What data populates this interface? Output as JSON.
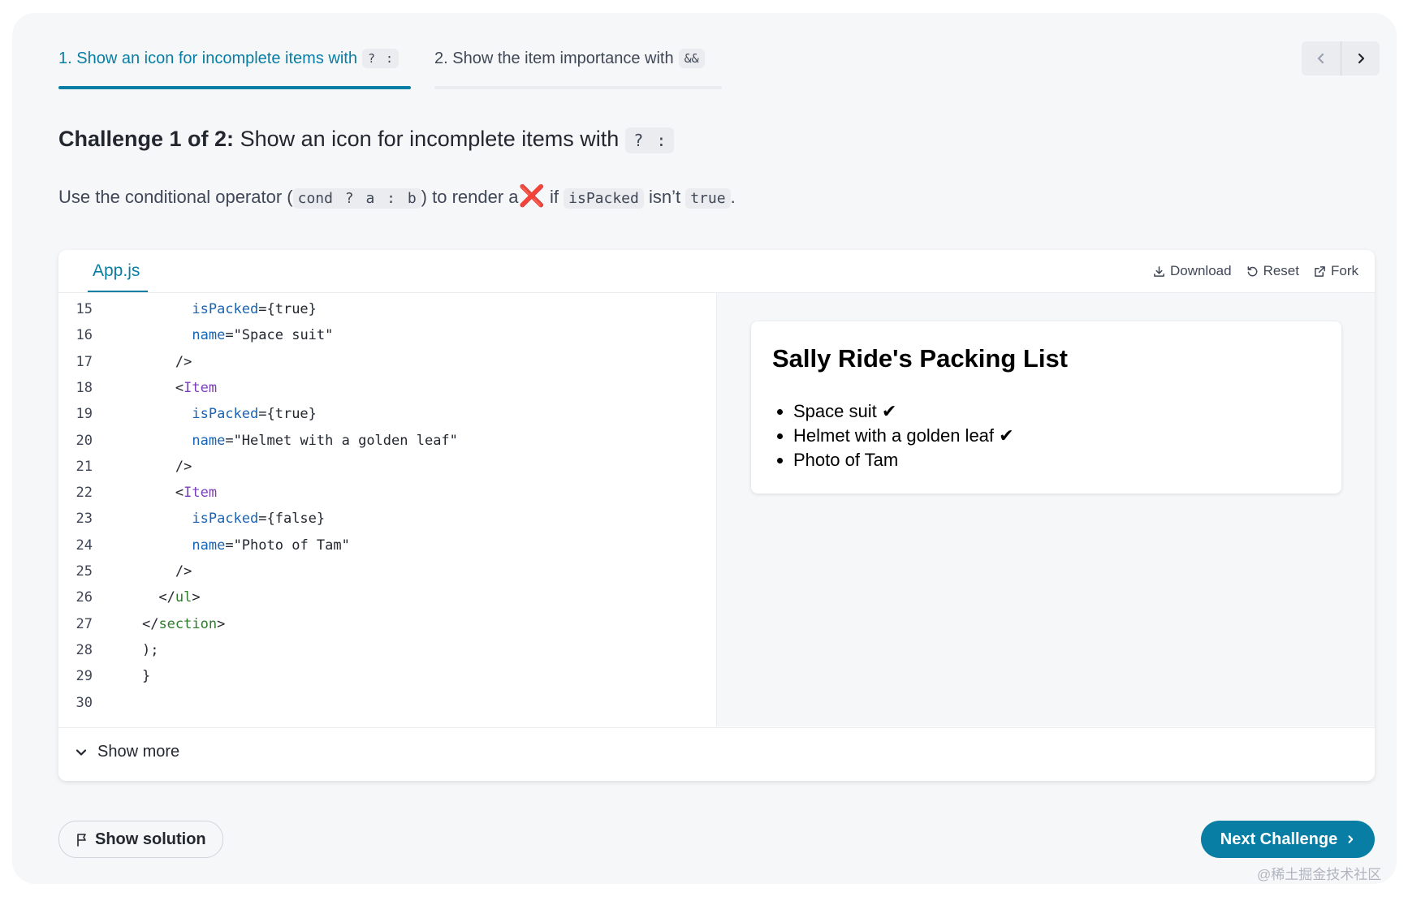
{
  "tabs": [
    {
      "label": "1. Show an icon for incomplete items with",
      "code": "? :",
      "active": true
    },
    {
      "label": "2. Show the item importance with",
      "code": "&&",
      "active": false
    }
  ],
  "challenge": {
    "prefix": "Challenge 1 of 2:",
    "title": "Show an icon for incomplete items with",
    "code": "? :",
    "desc": {
      "t1": "Use the conditional operator (",
      "c1": "cond ? a : b",
      "t2": ") to render a",
      "icon": "❌",
      "t3": "if",
      "c2": "isPacked",
      "t4": "isn’t",
      "c3": "true",
      "t5": "."
    }
  },
  "sandbox": {
    "file_tab": "App.js",
    "actions": {
      "download": "Download",
      "reset": "Reset",
      "fork": "Fork"
    },
    "code_lines": [
      {
        "n": "15",
        "indent": "      ",
        "parts": [
          [
            "attr",
            "isPacked"
          ],
          [
            "plain",
            "={true}"
          ]
        ]
      },
      {
        "n": "16",
        "indent": "      ",
        "parts": [
          [
            "attr",
            "name"
          ],
          [
            "plain",
            "="
          ],
          [
            "str",
            "\"Space suit\""
          ]
        ]
      },
      {
        "n": "17",
        "indent": "    ",
        "parts": [
          [
            "plain",
            "/>"
          ]
        ]
      },
      {
        "n": "18",
        "indent": "    ",
        "parts": [
          [
            "plain",
            "<"
          ],
          [
            "tag",
            "Item"
          ]
        ]
      },
      {
        "n": "19",
        "indent": "      ",
        "parts": [
          [
            "attr",
            "isPacked"
          ],
          [
            "plain",
            "={true}"
          ]
        ]
      },
      {
        "n": "20",
        "indent": "      ",
        "parts": [
          [
            "attr",
            "name"
          ],
          [
            "plain",
            "="
          ],
          [
            "str",
            "\"Helmet with a golden leaf\""
          ]
        ]
      },
      {
        "n": "21",
        "indent": "    ",
        "parts": [
          [
            "plain",
            "/>"
          ]
        ]
      },
      {
        "n": "22",
        "indent": "    ",
        "parts": [
          [
            "plain",
            "<"
          ],
          [
            "tag",
            "Item"
          ]
        ]
      },
      {
        "n": "23",
        "indent": "      ",
        "parts": [
          [
            "attr",
            "isPacked"
          ],
          [
            "plain",
            "={false}"
          ]
        ]
      },
      {
        "n": "24",
        "indent": "      ",
        "parts": [
          [
            "attr",
            "name"
          ],
          [
            "plain",
            "="
          ],
          [
            "str",
            "\"Photo of Tam\""
          ]
        ]
      },
      {
        "n": "25",
        "indent": "    ",
        "parts": [
          [
            "plain",
            "/>"
          ]
        ]
      },
      {
        "n": "26",
        "indent": "  ",
        "parts": [
          [
            "plain",
            "</"
          ],
          [
            "tag2",
            "ul"
          ],
          [
            "plain",
            ">"
          ]
        ]
      },
      {
        "n": "27",
        "indent": "",
        "parts": [
          [
            "plain",
            "</"
          ],
          [
            "tag2",
            "section"
          ],
          [
            "plain",
            ">"
          ]
        ]
      },
      {
        "n": "28",
        "indent": "",
        "parts": [
          [
            "plain",
            ");"
          ]
        ]
      },
      {
        "n": "29",
        "indent": "",
        "parts": [
          [
            "plain",
            "}"
          ]
        ]
      },
      {
        "n": "30",
        "indent": "",
        "parts": []
      }
    ],
    "preview": {
      "title": "Sally Ride's Packing List",
      "items": [
        "Space suit ✔",
        "Helmet with a golden leaf ✔",
        "Photo of Tam"
      ]
    },
    "show_more": "Show more"
  },
  "buttons": {
    "show_solution": "Show solution",
    "next_challenge": "Next Challenge"
  },
  "watermark": "@稀土掘金技术社区",
  "colors": {
    "accent": "#087ea4",
    "cross": "#e0201b"
  }
}
